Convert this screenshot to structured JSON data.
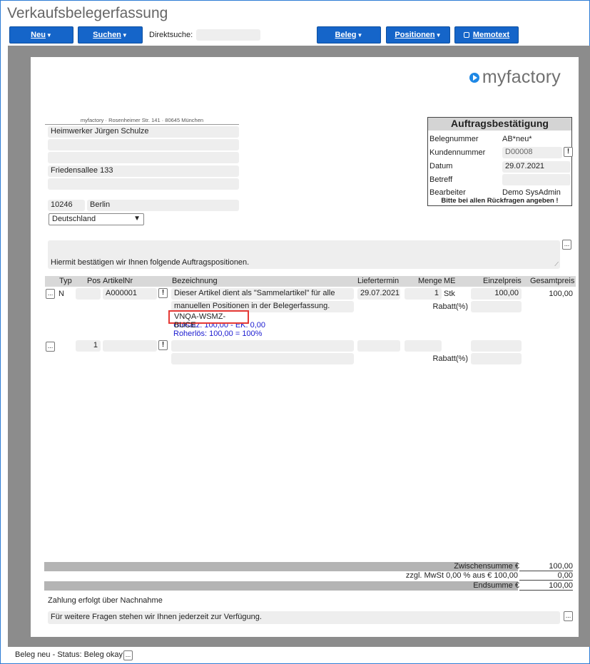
{
  "window": {
    "title": "Verkaufsbelegerfassung"
  },
  "toolbar": {
    "neu": "Neu",
    "suchen": "Suchen",
    "direktsuche_label": "Direktsuche:",
    "direktsuche_value": "",
    "beleg": "Beleg",
    "positionen": "Positionen",
    "memotext": "Memotext"
  },
  "logo": {
    "text": "myfactory"
  },
  "address": {
    "sender": "myfactory · Rosenheimer Str. 141 · 80645 München",
    "name": "Heimwerker Jürgen Schulze",
    "line2": "",
    "line3": "",
    "street": "Friedensallee 133",
    "line5": "",
    "zip": "10246",
    "city": "Berlin",
    "country": "Deutschland"
  },
  "info": {
    "title": "Auftragsbestätigung",
    "belegnummer_label": "Belegnummer",
    "belegnummer": "AB*neu*",
    "kundennummer_label": "Kundennummer",
    "kundennummer": "D00008",
    "datum_label": "Datum",
    "datum": "29.07.2021",
    "betreff_label": "Betreff",
    "betreff": "",
    "bearbeiter_label": "Bearbeiter",
    "bearbeiter": "Demo SysAdmin",
    "note": "Bitte bei allen Rückfragen angeben !"
  },
  "intro_text": "Hiermit bestätigen wir Ihnen folgende Auftragspositionen.",
  "table": {
    "headers": {
      "typ": "Typ",
      "pos": "Pos",
      "artikelnr": "ArtikelNr",
      "bezeichnung": "Bezeichnung",
      "liefertermin": "Liefertermin",
      "menge": "Menge",
      "me": "ME",
      "einzelpreis": "Einzelpreis",
      "gesamtpreis": "Gesamtpreis"
    },
    "row1": {
      "typ": "N",
      "pos": "",
      "artikelnr": "A000001",
      "bez1": "Dieser Artikel dient als \"Sammelartikel\" für alle",
      "bez2": "manuellen Positionen in der Belegerfassung.",
      "code": "VNQA-WSMZ-BUCE",
      "umsatz": "Umsatz: 100,00 - EK: 0,00",
      "rohertrag": "Roherlös: 100,00 = 100%",
      "liefertermin": "29.07.2021",
      "menge": "1",
      "me": "Stk",
      "einzelpreis": "100,00",
      "gesamtpreis": "100,00",
      "rabatt_label": "Rabatt(%)"
    },
    "row2": {
      "pos": "1",
      "rabatt_label": "Rabatt(%)"
    }
  },
  "totals": {
    "zwischensumme_label": "Zwischensumme €",
    "zwischensumme": "100,00",
    "mwst_label": "zzgl. MwSt 0,00 % aus € 100,00",
    "mwst": "0,00",
    "endsumme_label": "Endsumme €",
    "endsumme": "100,00"
  },
  "payment_text": "Zahlung erfolgt über Nachnahme",
  "footer_text": "Für weitere Fragen stehen wir Ihnen jederzeit zur Verfügung.",
  "status": {
    "text": "Beleg neu - Status: Beleg okay"
  },
  "colors": {
    "accent": "#1565c9",
    "highlight": "#e53935",
    "link_blue": "#1a1ad0"
  }
}
